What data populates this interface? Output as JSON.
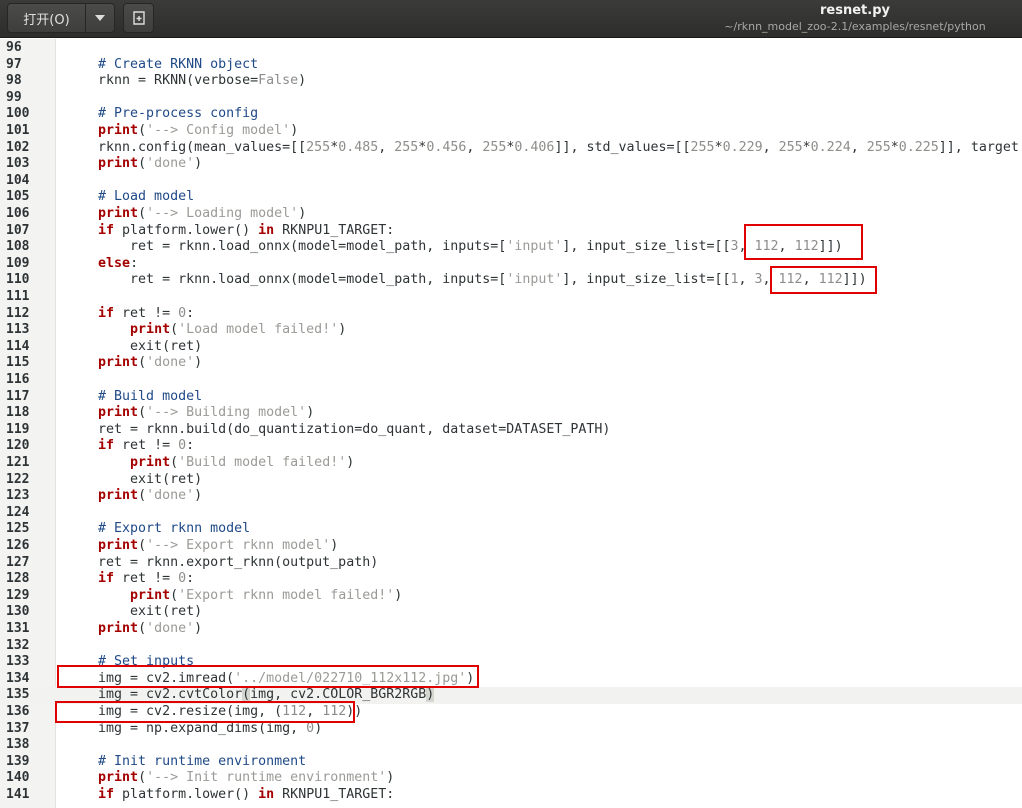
{
  "toolbar": {
    "open_label": "打开(O)",
    "open_menu_icon": "chevron-down-icon",
    "new_doc_icon": "new-document-icon"
  },
  "window": {
    "file_name": "resnet.py",
    "path": "~/rknn_model_zoo-2.1/examples/resnet/python"
  },
  "editor": {
    "current_line": 135,
    "lines": [
      {
        "n": "96",
        "tokens": []
      },
      {
        "n": "97",
        "tokens": [
          [
            "cm",
            "    # Create RKNN object"
          ]
        ]
      },
      {
        "n": "98",
        "tokens": [
          [
            "",
            "    rknn = RKNN(verbose="
          ],
          [
            "bool",
            "False"
          ],
          [
            "",
            ")"
          ]
        ]
      },
      {
        "n": "99",
        "tokens": []
      },
      {
        "n": "100",
        "tokens": [
          [
            "cm",
            "    # Pre-process config"
          ]
        ]
      },
      {
        "n": "101",
        "tokens": [
          [
            "",
            "    "
          ],
          [
            "kw",
            "print"
          ],
          [
            "",
            "("
          ],
          [
            "str",
            "'--> Config model'"
          ],
          [
            "",
            ")"
          ]
        ]
      },
      {
        "n": "102",
        "tokens": [
          [
            "",
            "    rknn.config(mean_values=[["
          ],
          [
            "num",
            "255"
          ],
          [
            "",
            "*"
          ],
          [
            "num",
            "0.485"
          ],
          [
            "",
            ", "
          ],
          [
            "num",
            "255"
          ],
          [
            "",
            "*"
          ],
          [
            "num",
            "0.456"
          ],
          [
            "",
            ", "
          ],
          [
            "num",
            "255"
          ],
          [
            "",
            "*"
          ],
          [
            "num",
            "0.406"
          ],
          [
            "",
            "]], std_values=[["
          ],
          [
            "num",
            "255"
          ],
          [
            "",
            "*"
          ],
          [
            "num",
            "0.229"
          ],
          [
            "",
            ", "
          ],
          [
            "num",
            "255"
          ],
          [
            "",
            "*"
          ],
          [
            "num",
            "0.224"
          ],
          [
            "",
            ", "
          ],
          [
            "num",
            "255"
          ],
          [
            "",
            "*"
          ],
          [
            "num",
            "0.225"
          ],
          [
            "",
            "]], target"
          ]
        ]
      },
      {
        "n": "103",
        "tokens": [
          [
            "",
            "    "
          ],
          [
            "kw",
            "print"
          ],
          [
            "",
            "("
          ],
          [
            "str",
            "'done'"
          ],
          [
            "",
            ")"
          ]
        ]
      },
      {
        "n": "104",
        "tokens": []
      },
      {
        "n": "105",
        "tokens": [
          [
            "cm",
            "    # Load model"
          ]
        ]
      },
      {
        "n": "106",
        "tokens": [
          [
            "",
            "    "
          ],
          [
            "kw",
            "print"
          ],
          [
            "",
            "("
          ],
          [
            "str",
            "'--> Loading model'"
          ],
          [
            "",
            ")"
          ]
        ]
      },
      {
        "n": "107",
        "tokens": [
          [
            "",
            "    "
          ],
          [
            "kw",
            "if"
          ],
          [
            "",
            " platform.lower() "
          ],
          [
            "kw",
            "in"
          ],
          [
            "",
            " RKNPU1_TARGET:"
          ]
        ]
      },
      {
        "n": "108",
        "tokens": [
          [
            "",
            "        ret = rknn.load_onnx(model=model_path, inputs=["
          ],
          [
            "str",
            "'input'"
          ],
          [
            "",
            "], input_size_list=[["
          ],
          [
            "num",
            "3"
          ],
          [
            "",
            ", "
          ],
          [
            "num",
            "112"
          ],
          [
            "",
            ", "
          ],
          [
            "num",
            "112"
          ],
          [
            "",
            "]])"
          ]
        ]
      },
      {
        "n": "109",
        "tokens": [
          [
            "",
            "    "
          ],
          [
            "kw",
            "else"
          ],
          [
            "",
            ":"
          ]
        ]
      },
      {
        "n": "110",
        "tokens": [
          [
            "",
            "        ret = rknn.load_onnx(model=model_path, inputs=["
          ],
          [
            "str",
            "'input'"
          ],
          [
            "",
            "], input_size_list=[["
          ],
          [
            "num",
            "1"
          ],
          [
            "",
            ", "
          ],
          [
            "num",
            "3"
          ],
          [
            "",
            ", "
          ],
          [
            "num",
            "112"
          ],
          [
            "",
            ", "
          ],
          [
            "num",
            "112"
          ],
          [
            "",
            "]])"
          ]
        ]
      },
      {
        "n": "111",
        "tokens": []
      },
      {
        "n": "112",
        "tokens": [
          [
            "",
            "    "
          ],
          [
            "kw",
            "if"
          ],
          [
            "",
            " ret != "
          ],
          [
            "num",
            "0"
          ],
          [
            "",
            ":"
          ]
        ]
      },
      {
        "n": "113",
        "tokens": [
          [
            "",
            "        "
          ],
          [
            "kw",
            "print"
          ],
          [
            "",
            "("
          ],
          [
            "str",
            "'Load model failed!'"
          ],
          [
            "",
            ")"
          ]
        ]
      },
      {
        "n": "114",
        "tokens": [
          [
            "",
            "        exit(ret)"
          ]
        ]
      },
      {
        "n": "115",
        "tokens": [
          [
            "",
            "    "
          ],
          [
            "kw",
            "print"
          ],
          [
            "",
            "("
          ],
          [
            "str",
            "'done'"
          ],
          [
            "",
            ")"
          ]
        ]
      },
      {
        "n": "116",
        "tokens": []
      },
      {
        "n": "117",
        "tokens": [
          [
            "cm",
            "    # Build model"
          ]
        ]
      },
      {
        "n": "118",
        "tokens": [
          [
            "",
            "    "
          ],
          [
            "kw",
            "print"
          ],
          [
            "",
            "("
          ],
          [
            "str",
            "'--> Building model'"
          ],
          [
            "",
            ")"
          ]
        ]
      },
      {
        "n": "119",
        "tokens": [
          [
            "",
            "    ret = rknn.build(do_quantization=do_quant, dataset=DATASET_PATH)"
          ]
        ]
      },
      {
        "n": "120",
        "tokens": [
          [
            "",
            "    "
          ],
          [
            "kw",
            "if"
          ],
          [
            "",
            " ret != "
          ],
          [
            "num",
            "0"
          ],
          [
            "",
            ":"
          ]
        ]
      },
      {
        "n": "121",
        "tokens": [
          [
            "",
            "        "
          ],
          [
            "kw",
            "print"
          ],
          [
            "",
            "("
          ],
          [
            "str",
            "'Build model failed!'"
          ],
          [
            "",
            ")"
          ]
        ]
      },
      {
        "n": "122",
        "tokens": [
          [
            "",
            "        exit(ret)"
          ]
        ]
      },
      {
        "n": "123",
        "tokens": [
          [
            "",
            "    "
          ],
          [
            "kw",
            "print"
          ],
          [
            "",
            "("
          ],
          [
            "str",
            "'done'"
          ],
          [
            "",
            ")"
          ]
        ]
      },
      {
        "n": "124",
        "tokens": []
      },
      {
        "n": "125",
        "tokens": [
          [
            "cm",
            "    # Export rknn model"
          ]
        ]
      },
      {
        "n": "126",
        "tokens": [
          [
            "",
            "    "
          ],
          [
            "kw",
            "print"
          ],
          [
            "",
            "("
          ],
          [
            "str",
            "'--> Export rknn model'"
          ],
          [
            "",
            ")"
          ]
        ]
      },
      {
        "n": "127",
        "tokens": [
          [
            "",
            "    ret = rknn.export_rknn(output_path)"
          ]
        ]
      },
      {
        "n": "128",
        "tokens": [
          [
            "",
            "    "
          ],
          [
            "kw",
            "if"
          ],
          [
            "",
            " ret != "
          ],
          [
            "num",
            "0"
          ],
          [
            "",
            ":"
          ]
        ]
      },
      {
        "n": "129",
        "tokens": [
          [
            "",
            "        "
          ],
          [
            "kw",
            "print"
          ],
          [
            "",
            "("
          ],
          [
            "str",
            "'Export rknn model failed!'"
          ],
          [
            "",
            ")"
          ]
        ]
      },
      {
        "n": "130",
        "tokens": [
          [
            "",
            "        exit(ret)"
          ]
        ]
      },
      {
        "n": "131",
        "tokens": [
          [
            "",
            "    "
          ],
          [
            "kw",
            "print"
          ],
          [
            "",
            "("
          ],
          [
            "str",
            "'done'"
          ],
          [
            "",
            ")"
          ]
        ]
      },
      {
        "n": "132",
        "tokens": []
      },
      {
        "n": "133",
        "tokens": [
          [
            "cm",
            "    # Set inputs"
          ]
        ]
      },
      {
        "n": "134",
        "tokens": [
          [
            "",
            "    img = cv2.imread("
          ],
          [
            "str",
            "'../model/022710_112x112.jpg'"
          ],
          [
            "",
            ")"
          ]
        ]
      },
      {
        "n": "135",
        "tokens": [
          [
            "",
            "    img = cv2.cvtColor"
          ],
          [
            "sel",
            "("
          ],
          [
            "",
            "img, cv2.COLOR_BGR2RGB"
          ],
          [
            "sel",
            ")"
          ]
        ]
      },
      {
        "n": "136",
        "tokens": [
          [
            "",
            "    img = cv2.resize(img, ("
          ],
          [
            "num",
            "112"
          ],
          [
            "",
            ", "
          ],
          [
            "num",
            "112"
          ],
          [
            "",
            "))"
          ]
        ]
      },
      {
        "n": "137",
        "tokens": [
          [
            "",
            "    img = np.expand_dims(img, "
          ],
          [
            "num",
            "0"
          ],
          [
            "",
            ")"
          ]
        ]
      },
      {
        "n": "138",
        "tokens": []
      },
      {
        "n": "139",
        "tokens": [
          [
            "cm",
            "    # Init runtime environment"
          ]
        ]
      },
      {
        "n": "140",
        "tokens": [
          [
            "",
            "    "
          ],
          [
            "kw",
            "print"
          ],
          [
            "",
            "("
          ],
          [
            "str",
            "'--> Init runtime environment'"
          ],
          [
            "",
            ")"
          ]
        ]
      },
      {
        "n": "141",
        "tokens": [
          [
            "",
            "    "
          ],
          [
            "kw",
            "if"
          ],
          [
            "",
            " platform.lower() "
          ],
          [
            "kw",
            "in"
          ],
          [
            "",
            " RKNPU1_TARGET:"
          ]
        ]
      }
    ]
  }
}
